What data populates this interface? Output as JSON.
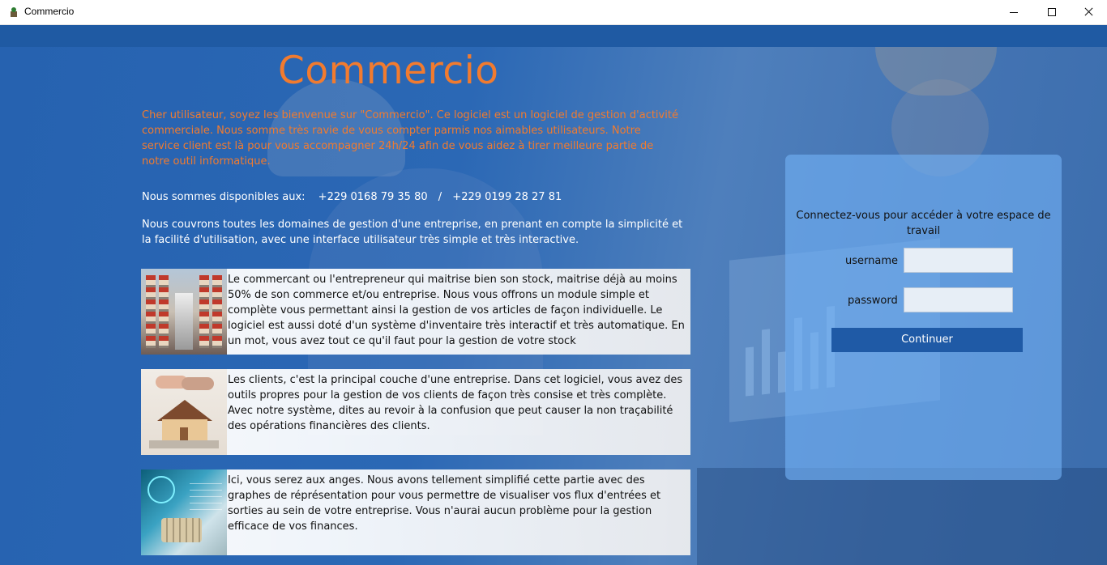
{
  "window": {
    "title": "Commercio",
    "icon": "app-icon",
    "controls": [
      "minimize-icon",
      "maximize-icon",
      "close-icon"
    ]
  },
  "brand": "Commercio",
  "welcome_text": "Cher utilisateur, soyez les bienvenue sur \"Commercio\". Ce logiciel est un logiciel de gestion d'activité commerciale. Nous somme très ravie de vous compter parmis nos aimables utilisateurs. Notre service client est là pour vous accompagner 24h/24 afin de vous aidez à tirer meilleure partie de notre outil informatique.",
  "availability": {
    "label": "Nous sommes disponibles aux:",
    "phone1": "+229 0168 79 35 80",
    "separator": "/",
    "phone2": "+229 0199 28 27 81"
  },
  "domains_text": "Nous couvrons toutes les domaines de gestion d'une entreprise, en prenant en compte la simplicité et la facilité d'utilisation, avec une interface utilisateur très simple et très interactive.",
  "features": [
    {
      "image": "warehouse-image",
      "text": "Le commercant ou l'entrepreneur qui maitrise bien son stock, maitrise déjà au moins 50%  de son commerce et/ou entreprise. Nous vous offrons un module simple et complète vous permettant ainsi la gestion de vos articles de façon individuelle. Le logiciel est aussi doté d'un système d'inventaire très interactif et très automatique. En un mot, vous avez tout ce qu'il faut pour la gestion de votre stock"
    },
    {
      "image": "handshake-house-image",
      "text": "Les clients, c'est la principal couche d'une entreprise. Dans cet logiciel, vous avez des outils propres pour la gestion de vos clients de façon très consise et très complète. Avec notre système, dites au revoir à la confusion que peut causer la non traçabilité des opérations financières des clients."
    },
    {
      "image": "finance-image",
      "text": "Ici, vous serez aux anges. Nous avons tellement simplifié cette partie avec des graphes de réprésentation pour vous permettre de visualiser vos flux d'entrées et sorties au sein de votre entreprise. Vous n'aurai aucun problème pour la gestion efficace de vos finances."
    }
  ],
  "login": {
    "heading": "Connectez-vous pour accéder à votre espace de travail",
    "username_label": "username",
    "username_value": "",
    "password_label": "password",
    "password_value": "",
    "submit_label": "Continuer"
  },
  "colors": {
    "accent": "#f17b2f",
    "background": "#1c5aa6",
    "panel": "#73b2f5",
    "button": "#1f5aa6"
  }
}
